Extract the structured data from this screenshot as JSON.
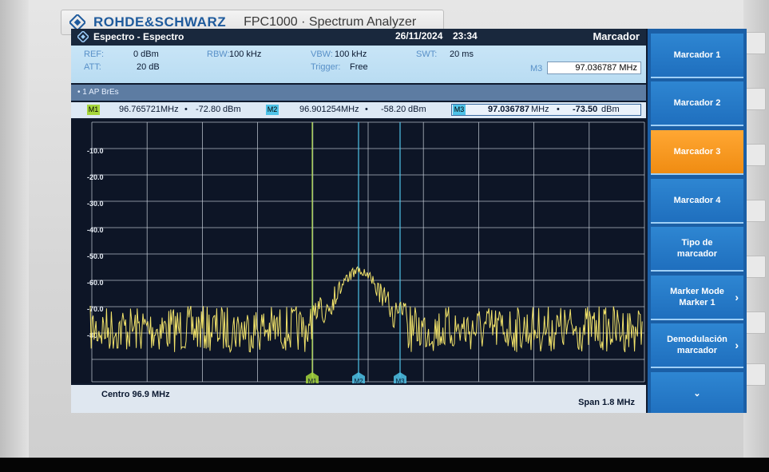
{
  "device": {
    "brand": "ROHDE&SCHWARZ",
    "model": "FPC1000 · Spectrum Analyzer"
  },
  "header": {
    "title": "Espectro - Espectro",
    "date": "26/11/2024",
    "time": "23:34",
    "panel_title": "Marcador"
  },
  "settings": {
    "ref_label": "REF:",
    "ref_value": "0 dBm",
    "att_label": "ATT:",
    "att_value": "20 dB",
    "rbw_label": "RBW:",
    "rbw_value": "100 kHz",
    "vbw_label": "VBW:",
    "vbw_value": "100 kHz",
    "trigger_label": "Trigger:",
    "trigger_value": "Free",
    "swt_label": "SWT:",
    "swt_value": "20 ms",
    "active_marker_label": "M3",
    "active_marker_value": "97.036787 MHz"
  },
  "trace_info": "• 1 AP  BrEs",
  "markers": [
    {
      "tag": "M1",
      "freq": "96.765721",
      "freq_unit": "MHz",
      "dot": "•",
      "level": "-72.80",
      "level_unit": "dBm",
      "color": "#a6d63c"
    },
    {
      "tag": "M2",
      "freq": "96.901254",
      "freq_unit": "MHz",
      "dot": "•",
      "level": "-58.20",
      "level_unit": "dBm",
      "color": "#4fc3e8"
    },
    {
      "tag": "M3",
      "freq": "97.036787",
      "freq_unit": "MHz",
      "dot": "•",
      "level": "-73.50",
      "level_unit": "dBm",
      "color": "#4fc3e8"
    }
  ],
  "y_ticks": [
    "-10.0",
    "-20.0",
    "-30.0",
    "-40.0",
    "-50.0",
    "-60.0",
    "-70.0",
    "-80"
  ],
  "footer": {
    "center": "Centro 96.9 MHz",
    "span": "Span 1.8 MHz"
  },
  "softkeys": [
    {
      "label": "Marcador 1",
      "active": false,
      "chevron": ""
    },
    {
      "label": "Marcador 2",
      "active": false,
      "chevron": ""
    },
    {
      "label": "Marcador 3",
      "active": true,
      "chevron": ""
    },
    {
      "label": "Marcador 4",
      "active": false,
      "chevron": ""
    },
    {
      "label": "Tipo de\nmarcador",
      "active": false,
      "chevron": ""
    },
    {
      "label": "Marker Mode\nMarker 1",
      "active": false,
      "chevron": "›"
    },
    {
      "label": "Demodulación\nmarcador",
      "active": false,
      "chevron": "›"
    },
    {
      "label": "⌄",
      "active": false,
      "chevron": ""
    }
  ],
  "colors": {
    "trace": "#f2e36a",
    "grid": "#cfd6e0",
    "active_softkey": "#f59a20",
    "softkey": "#2379c6"
  }
}
